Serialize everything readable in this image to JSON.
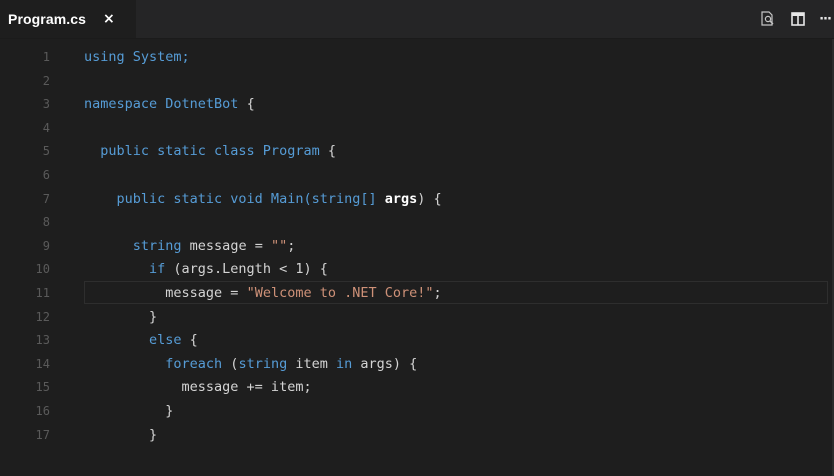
{
  "tab": {
    "filename": "Program.cs",
    "close_glyph": "×"
  },
  "actions": {
    "find_icon": "search-file-icon",
    "split_icon": "split-editor-icon",
    "more_label": "···"
  },
  "colors": {
    "background": "#1e1e1e",
    "keyword": "#569cd6",
    "string": "#ce9178",
    "line_number": "#5a5a5a"
  },
  "editor": {
    "line_numbers": [
      "1",
      "2",
      "3",
      "4",
      "5",
      "6",
      "7",
      "8",
      "9",
      "10",
      "11",
      "12",
      "13",
      "14",
      "15",
      "16",
      "17"
    ],
    "current_line": 11,
    "lines": [
      [
        {
          "t": "using System;",
          "c": "kw"
        }
      ],
      [],
      [
        {
          "t": "namespace DotnetBot",
          "c": "kw"
        },
        {
          "t": " {",
          "c": ""
        }
      ],
      [],
      [
        {
          "t": "  public static class Program",
          "c": "kw"
        },
        {
          "t": " {",
          "c": ""
        }
      ],
      [],
      [
        {
          "t": "    public static void Main(string[]",
          "c": "kw"
        },
        {
          "t": " ",
          "c": ""
        },
        {
          "t": "args",
          "c": "param"
        },
        {
          "t": ") {",
          "c": ""
        }
      ],
      [],
      [
        {
          "t": "      string",
          "c": "kw"
        },
        {
          "t": " message = ",
          "c": ""
        },
        {
          "t": "\"\"",
          "c": "str"
        },
        {
          "t": ";",
          "c": ""
        }
      ],
      [
        {
          "t": "        if",
          "c": "kw"
        },
        {
          "t": " (args.Length < 1) {",
          "c": ""
        }
      ],
      [
        {
          "t": "          message = ",
          "c": ""
        },
        {
          "t": "\"Welcome to .NET Core!\"",
          "c": "str"
        },
        {
          "t": ";",
          "c": ""
        }
      ],
      [
        {
          "t": "        }",
          "c": ""
        }
      ],
      [
        {
          "t": "        else",
          "c": "kw"
        },
        {
          "t": " {",
          "c": ""
        }
      ],
      [
        {
          "t": "          foreach",
          "c": "kw"
        },
        {
          "t": " (",
          "c": ""
        },
        {
          "t": "string",
          "c": "kw"
        },
        {
          "t": " item ",
          "c": ""
        },
        {
          "t": "in",
          "c": "kw"
        },
        {
          "t": " args) {",
          "c": ""
        }
      ],
      [
        {
          "t": "            message += item;",
          "c": ""
        }
      ],
      [
        {
          "t": "          }",
          "c": ""
        }
      ],
      [
        {
          "t": "        }",
          "c": ""
        }
      ]
    ]
  }
}
